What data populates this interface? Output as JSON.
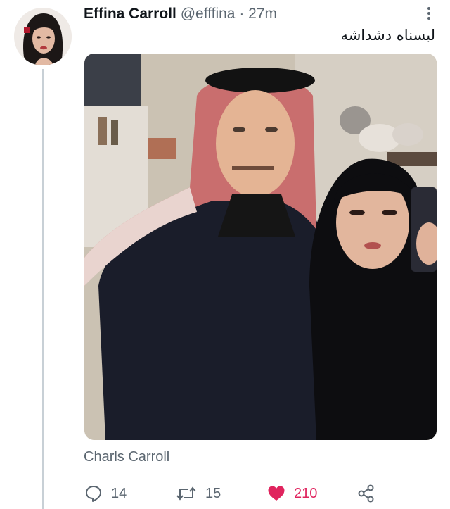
{
  "tweet": {
    "display_name": "Effina Carroll",
    "handle": "@efffina",
    "separator": "·",
    "time": "27m",
    "text": "لبسناه دشداشه",
    "caption": "Charls Carroll"
  },
  "actions": {
    "replies": "14",
    "retweets": "15",
    "likes": "210"
  },
  "icons": {
    "more": "more-vertical-icon",
    "reply": "reply-icon",
    "retweet": "retweet-icon",
    "like": "heart-icon",
    "share": "share-icon"
  },
  "colors": {
    "like": "#e0245e",
    "muted": "#5b6670",
    "thread_line": "#c8d0d6"
  }
}
